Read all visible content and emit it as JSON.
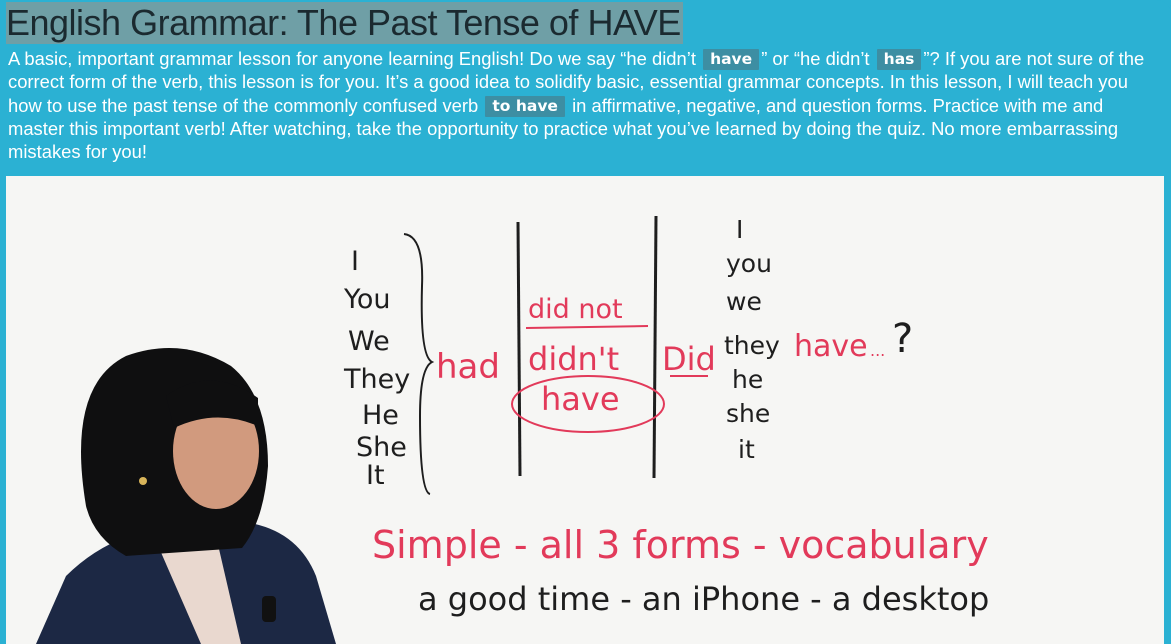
{
  "lesson": {
    "title": "English Grammar: The Past Tense of HAVE",
    "desc_1": "A basic, important grammar lesson for anyone learning English! Do we say “he didn’t ",
    "hl_have": "have",
    "desc_2": "” or “he didn’t ",
    "hl_has": "has",
    "desc_3": "”? If you are not sure of the correct form of the verb, this lesson is for you. It’s a good idea to solidify basic, essential grammar concepts. In this lesson, I will teach you how to use the past tense of the commonly confused verb ",
    "hl_to_have": "to have",
    "desc_4": " in affirmative, negative, and question forms. Practice with me and master this important verb! After watching, take the opportunity to practice what you’ve learned by doing the quiz. No more embarrassing mistakes for you!"
  },
  "board": {
    "pronouns_left": [
      "I",
      "You",
      "We",
      "They",
      "He",
      "She",
      "It"
    ],
    "had": "had",
    "did_not": "did not",
    "didnt": "didn't",
    "have_neg": "have",
    "did": "Did",
    "pronouns_right": [
      "I",
      "you",
      "we",
      "they",
      "he",
      "she",
      "it"
    ],
    "have_q": "have",
    "ellipsis": "...",
    "qmark": "?",
    "line1": "Simple - all 3 forms - vocabulary",
    "line2": "a good time - an iPhone - a desktop"
  },
  "colors": {
    "background": "#2bb1d3",
    "title_bg": "#6f9fa6",
    "highlight_bg": "#3d8ea3",
    "marker_black": "#1e1e1e",
    "marker_red": "#e23a5a"
  }
}
